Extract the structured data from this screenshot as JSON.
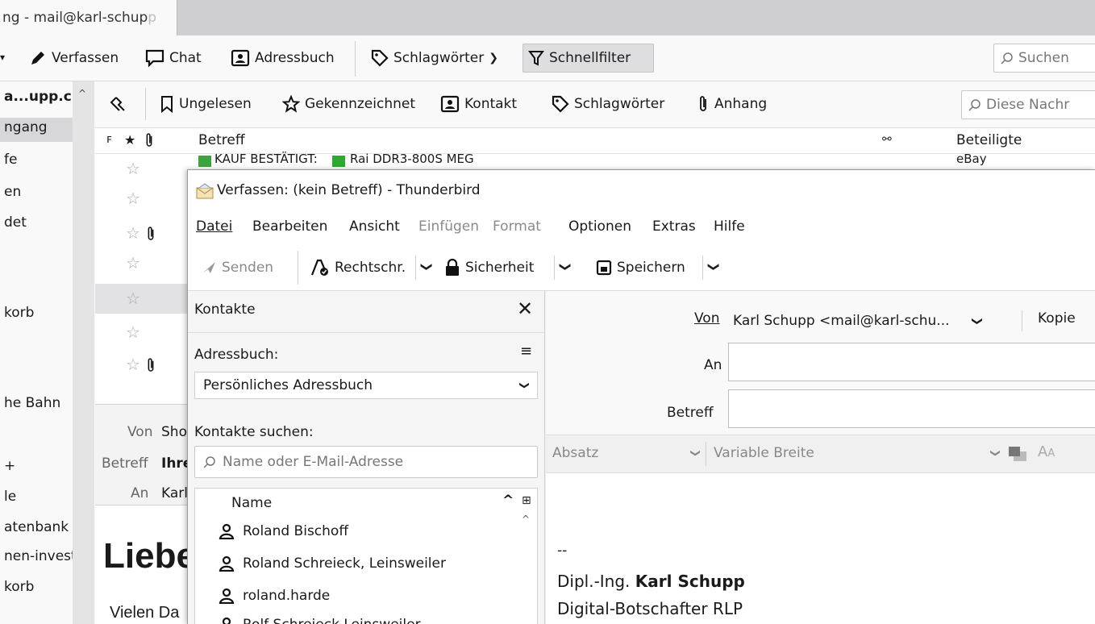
{
  "tab": {
    "title_visible": "ng - mail@karl-schup",
    "title_faded": "p"
  },
  "toolbar": {
    "compose": "Verfassen",
    "chat": "Chat",
    "addressbook": "Adressbuch",
    "tags": "Schlagwörter",
    "quickfilter": "Schnellfilter",
    "search_placeholder": "Suchen"
  },
  "folders": {
    "account": "a...upp.c",
    "items": [
      "ngang",
      "fe",
      "en",
      "det",
      "korb",
      "he Bahn",
      "+",
      "le",
      "atenbank",
      "nen-invest",
      "korb"
    ]
  },
  "quickfilter": {
    "unread": "Ungelesen",
    "starred": "Gekennzeichnet",
    "contact": "Kontakt",
    "tags": "Schlagwörter",
    "attachment": "Anhang",
    "search_placeholder": "Diese Nachr"
  },
  "threadlist": {
    "col_subject": "Betreff",
    "col_participants": "Beteiligte",
    "partial_row_subject": "KAUF BESTÄTIGT:",
    "partial_row_item": "Rai DDR3-800S MEG",
    "partial_row_sender": "eBay"
  },
  "message": {
    "from_label": "Von",
    "from_value": "Sho",
    "subject_label": "Betreff",
    "subject_value": "Ihre",
    "to_label": "An",
    "to_value": "Karl",
    "heading": "Liebe",
    "body_line": "Vielen Da"
  },
  "compose": {
    "title": "Verfassen: (kein Betreff) - Thunderbird",
    "menu": {
      "datei": "Datei",
      "bearbeiten": "Bearbeiten",
      "ansicht": "Ansicht",
      "einfuegen": "Einfügen",
      "format": "Format",
      "optionen": "Optionen",
      "extras": "Extras",
      "hilfe": "Hilfe"
    },
    "toolbar": {
      "send": "Senden",
      "spell": "Rechtschr.",
      "security": "Sicherheit",
      "save": "Speichern"
    },
    "contacts": {
      "title": "Kontakte",
      "addressbook_label": "Adressbuch:",
      "addressbook_value": "Persönliches Adressbuch",
      "search_label": "Kontakte suchen:",
      "search_placeholder": "Name oder E-Mail-Adresse",
      "col_name": "Name",
      "list": [
        "Roland Bischoff",
        "Roland Schreieck, Leinsweiler",
        "roland.harde",
        "Rolf Schreieck Leinsweiler"
      ]
    },
    "headers": {
      "from_label": "Von",
      "from_value": "Karl Schupp <mail@karl-schu...",
      "copy_label": "Kopie",
      "to_label": "An",
      "subject_label": "Betreff"
    },
    "format": {
      "paragraph": "Absatz",
      "font": "Variable Breite"
    },
    "signature": {
      "sep": "--",
      "title_prefix": "Dipl.-Ing. ",
      "name": "Karl Schupp",
      "role": "Digital-Botschafter RLP"
    }
  }
}
